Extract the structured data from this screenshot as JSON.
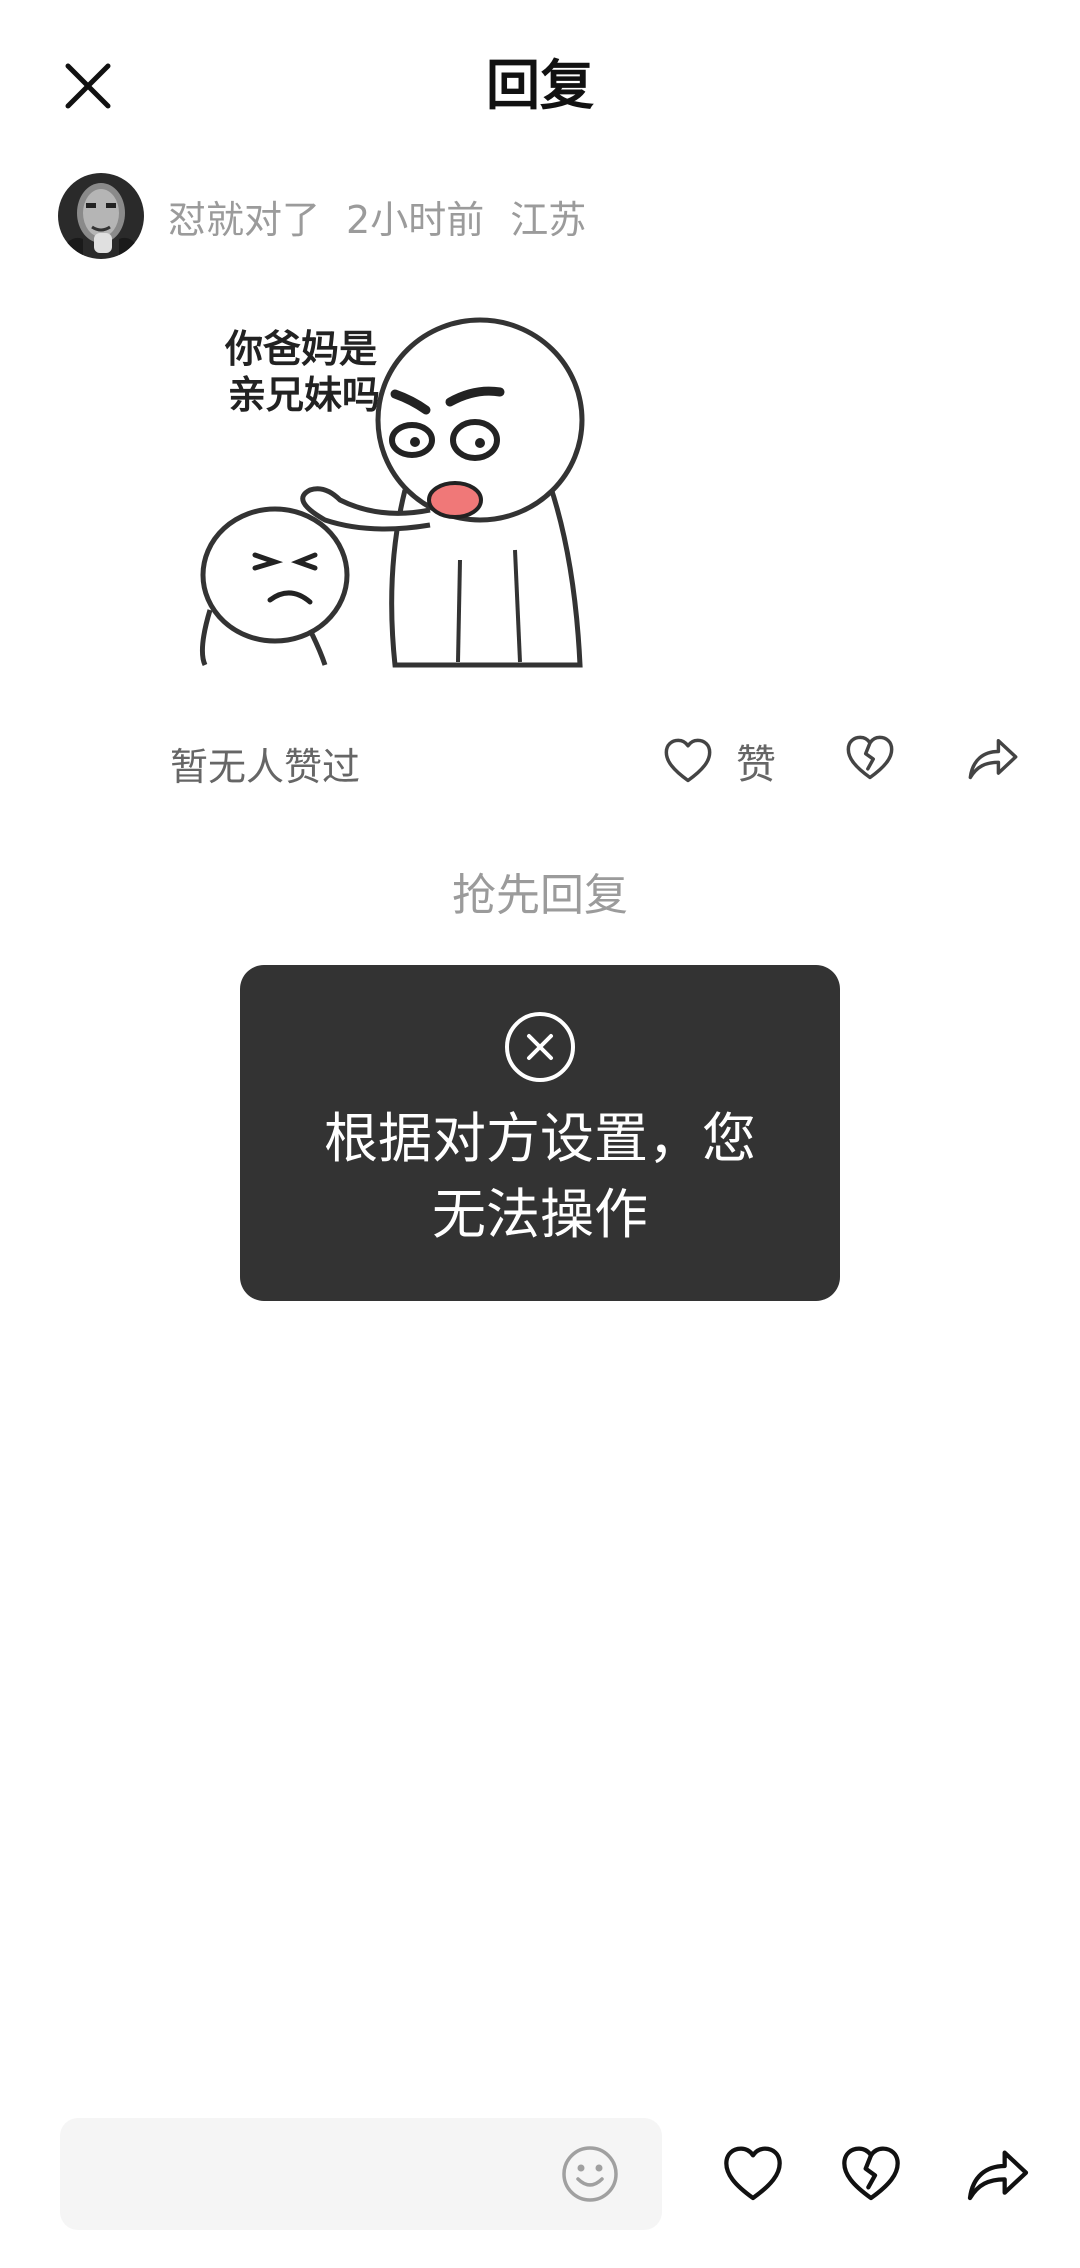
{
  "header": {
    "title": "回复"
  },
  "author": {
    "name": "怼就对了",
    "time": "2小时前",
    "location": "江苏"
  },
  "sticker": {
    "text_line1": "你爸妈是",
    "text_line2": "亲兄妹吗"
  },
  "actions": {
    "likes_text": "暂无人赞过",
    "like_label": "赞"
  },
  "first_reply_text": "抢先回复",
  "toast": {
    "line1": "根据对方设置，您",
    "line2": "无法操作"
  },
  "bottom_bar": {
    "input_value": "",
    "input_placeholder": ""
  },
  "icons": {
    "close": "close-icon",
    "heart": "heart-icon",
    "broken_heart": "broken-heart-icon",
    "share": "share-icon",
    "emoji": "emoji-icon",
    "toast": "circle-x-icon"
  },
  "colors": {
    "toast_bg": "#333333",
    "meta_text": "#9b9b9b",
    "input_bg": "#f5f5f5",
    "sticker_mouth": "#f07878"
  }
}
